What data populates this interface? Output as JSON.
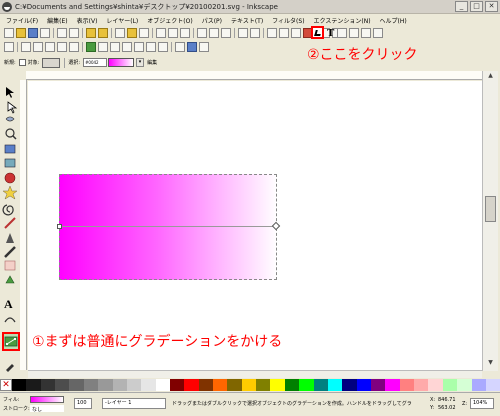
{
  "window": {
    "title": "C:¥Documents and Settings¥shinta¥デスクトップ¥20100201.svg - Inkscape",
    "buttons": [
      "_",
      "□",
      "✕"
    ]
  },
  "menubar": [
    "ファイル(F)",
    "編集(E)",
    "表示(V)",
    "レイヤー(L)",
    "オブジェクト(O)",
    "パス(P)",
    "テキスト(T)",
    "フィルタ(S)",
    "エクステンション(N)",
    "ヘルプ(H)"
  ],
  "tool_controls": {
    "new_label": "新規:",
    "target_label": "対象:",
    "selected_label": "選択:",
    "gradient_name": "#0042",
    "edit_label": "編集"
  },
  "annotations": {
    "step1": "①まずは普通にグラデーションをかける",
    "step2": "②ここをクリック"
  },
  "palette": {
    "none_symbol": "✕",
    "colors": [
      "#000000",
      "#1a1a1a",
      "#333333",
      "#4d4d4d",
      "#666666",
      "#808080",
      "#999999",
      "#b3b3b3",
      "#cccccc",
      "#e6e6e6",
      "#ffffff",
      "#800000",
      "#ff0000",
      "#803300",
      "#ff6600",
      "#806600",
      "#ffcc00",
      "#808000",
      "#ffff00",
      "#008000",
      "#00ff00",
      "#008080",
      "#00ffff",
      "#000080",
      "#0000ff",
      "#800080",
      "#ff00ff",
      "#ff8080",
      "#ffaaaa",
      "#ffd5d5",
      "#aaffaa",
      "#d5ffd5",
      "#aaaaff",
      "#d5d5ff"
    ]
  },
  "statusbar": {
    "fill_label": "フィル:",
    "stroke_label": "ストローク:",
    "stroke_value": "なし",
    "opacity_value": "100",
    "layer_value": "-レイヤー 1",
    "message": "ドラッグまたはダブルクリックで選択オブジェクトのグラデーションを作成。ハンドルをドラッグしてグラデー",
    "x_label": "X:",
    "x_value": "846.71",
    "y_label": "Y:",
    "y_value": "563.02",
    "z_label": "Z:",
    "zoom_value": "104%"
  }
}
